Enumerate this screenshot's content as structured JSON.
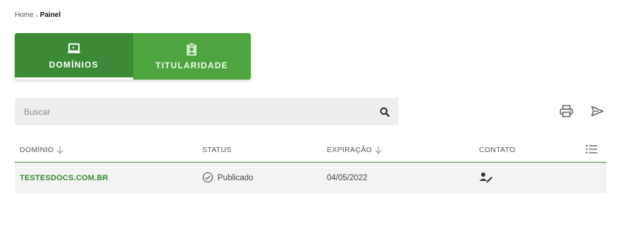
{
  "breadcrumb": {
    "home": "Home",
    "separator": "›",
    "current": "Painel"
  },
  "tabs": [
    {
      "label": "DOMÍNIOS",
      "icon": "laptop-icon",
      "active": true
    },
    {
      "label": "TITULARIDADE",
      "icon": "id-badge-icon",
      "active": false
    }
  ],
  "search": {
    "placeholder": "Buscar",
    "value": ""
  },
  "actions": {
    "print_icon": "print-icon",
    "send_icon": "send-icon"
  },
  "table": {
    "columns": [
      {
        "label": "DOMÍNIO",
        "sortable": true
      },
      {
        "label": "STATUS",
        "sortable": false
      },
      {
        "label": "EXPIRAÇÃO",
        "sortable": true
      },
      {
        "label": "CONTATO",
        "sortable": false
      }
    ],
    "rows": [
      {
        "domain": "TESTESDOCS.COM.BR",
        "status": "Publicado",
        "expiration": "04/05/2022",
        "contact_icon": "person-edit-icon"
      }
    ]
  },
  "colors": {
    "accent": "#3a8a36",
    "accent_light": "#4ea53f",
    "row_bg": "#f3f3f3",
    "search_bg": "#eeeeee"
  }
}
